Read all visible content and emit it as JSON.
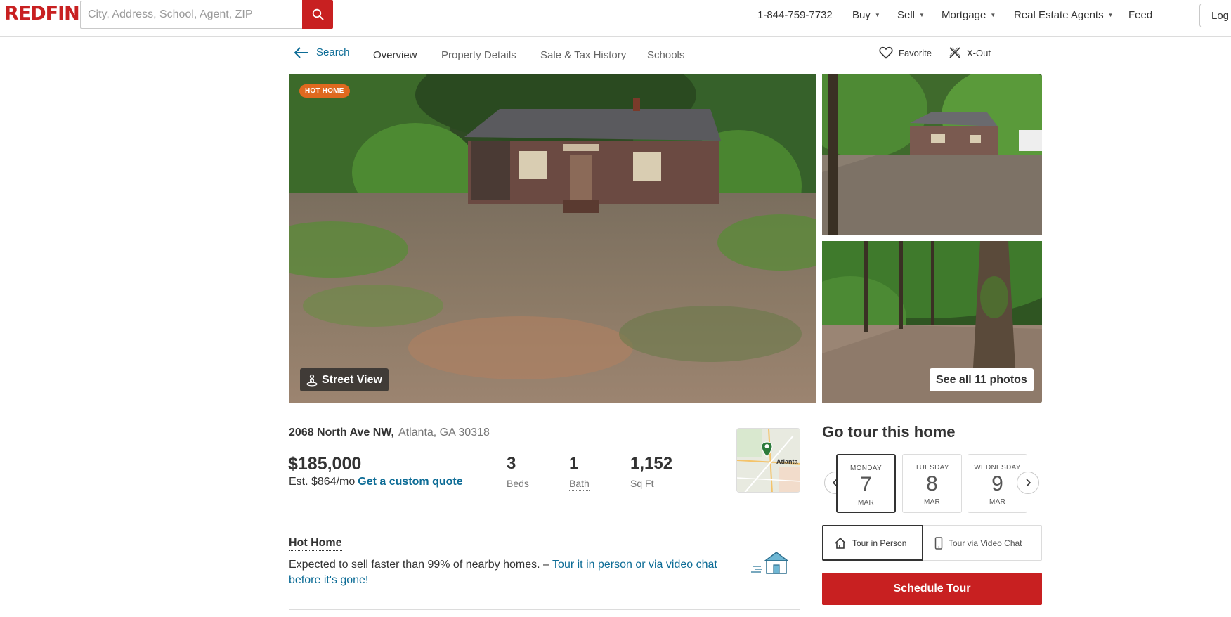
{
  "header": {
    "logo": "REDFIN",
    "search_placeholder": "City, Address, School, Agent, ZIP",
    "phone": "1-844-759-7732",
    "nav": [
      {
        "label": "Buy",
        "has_caret": true
      },
      {
        "label": "Sell",
        "has_caret": true
      },
      {
        "label": "Mortgage",
        "has_caret": true
      },
      {
        "label": "Real Estate Agents",
        "has_caret": true
      },
      {
        "label": "Feed",
        "has_caret": false
      }
    ],
    "login_label": "Log"
  },
  "subnav": {
    "back_label": "Search",
    "tabs": [
      {
        "label": "Overview",
        "active": true
      },
      {
        "label": "Property Details",
        "active": false
      },
      {
        "label": "Sale & Tax History",
        "active": false
      },
      {
        "label": "Schools",
        "active": false
      }
    ],
    "favorite_label": "Favorite",
    "xout_label": "X-Out"
  },
  "photos": {
    "badge": "HOT HOME",
    "street_view_label": "Street View",
    "see_all_label": "See all 11 photos"
  },
  "listing": {
    "street": "2068 North Ave NW,",
    "city_state_zip": "Atlanta, GA 30318",
    "price": "$185,000",
    "est_payment": "Est. $864/mo",
    "quote_link": "Get a custom quote",
    "stats": [
      {
        "value": "3",
        "label": "Beds"
      },
      {
        "value": "1",
        "label": "Bath"
      },
      {
        "value": "1,152",
        "label": "Sq Ft"
      }
    ],
    "map_city_label": "Atlanta"
  },
  "hot_home": {
    "title": "Hot Home",
    "text": "Expected to sell faster than 99% of nearby homes. – ",
    "link": "Tour it in person or via video chat before it's gone!"
  },
  "tour": {
    "title": "Go tour this home",
    "days": [
      {
        "name": "MONDAY",
        "num": "7",
        "month": "MAR",
        "selected": true
      },
      {
        "name": "TUESDAY",
        "num": "8",
        "month": "MAR",
        "selected": false
      },
      {
        "name": "WEDNESDAY",
        "num": "9",
        "month": "MAR",
        "selected": false
      }
    ],
    "in_person_label": "Tour in Person",
    "video_label": "Tour via Video Chat",
    "schedule_label": "Schedule Tour"
  },
  "colors": {
    "brand_red": "#c82021",
    "link_blue": "#0d6c96",
    "badge_orange": "#e0691f"
  }
}
